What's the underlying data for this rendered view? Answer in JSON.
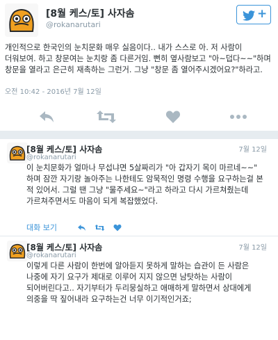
{
  "main_tweet": {
    "name": "[8월 케스/토] 사자솜",
    "handle": "@rokanarutari",
    "text": "개인적으로 한국인의 눈치문화 매우 싫음이다.. 내가 스스로 아. 저 사람이 더워보여. 하고 창문여는 눈치랑 좀 다른거임. 뻔히 옆사람보고 \"아~덥다~~\"하며 창문을 열라고 은근히 재촉하는 그런거. 그냥 \"창문 좀 열어주시겠어요?\"하라고.",
    "timestamp": "오전 10:42 - 2016년 7월 12일",
    "follow_icon": "twitter-bird-icon",
    "follow_plus": "+"
  },
  "actions": [
    {
      "icon": "reply-icon"
    },
    {
      "icon": "retweet-icon"
    },
    {
      "icon": "like-heart-icon"
    },
    {
      "icon": "more-dots-icon"
    }
  ],
  "replies": [
    {
      "name": "[8월 케스/토] 사자솜",
      "handle": "@rokanarutari",
      "date": "7월 12일",
      "text": "이 눈치문화가 얼마나 무섭냐면 5살짜리가 \"아 갑자기 목이 마르네~~\" 하며 잠깐 자기랑 놀아주는 나한테도 암묵적인 명령 수행을 요구하는걸 본 적 있어서. 그럴 땐 그냥 \"물주세요~\"라고 하라고 다시 가르쳐줬는데 가르쳐주면서도 마음이 되게 복잡했었다.",
      "convo_label": "대화 보기"
    },
    {
      "name": "[8월 케스/토] 사자솜",
      "handle": "@rokanarutari",
      "date": "7월 12일",
      "text": "이렇게 다른 사람이 한번에 알아듣지 못하게 말하는 습관이 든 사람은 나중에 자기 요구가 제대로 이루어 지지 않으면 남탓하는 사람이 되어버린다고.. 자기부터가 두리뭉실하고 애매하게 말하면서 상대에게 의중을 딱 짚어내라 요구하는건 너무 이기적인거죠;"
    }
  ],
  "colors": {
    "accent": "#3b94d9",
    "muted": "#8899a6",
    "icon": "#aab8c2",
    "separator": "#e6ecf0",
    "avatar": "#f0a020"
  }
}
